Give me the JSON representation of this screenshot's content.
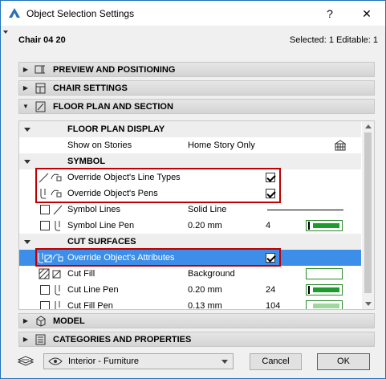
{
  "window": {
    "title": "Object Selection Settings",
    "help_label": "?",
    "close_label": "✕"
  },
  "object": {
    "name": "Chair 04 20",
    "selection_info": "Selected: 1 Editable: 1"
  },
  "panels": {
    "preview": "PREVIEW AND POSITIONING",
    "chair": "CHAIR SETTINGS",
    "floorplan": "FLOOR PLAN AND SECTION",
    "model": "MODEL",
    "categories": "CATEGORIES AND PROPERTIES"
  },
  "grid": {
    "floor_plan_display": {
      "label": "FLOOR PLAN DISPLAY",
      "show_on_stories_label": "Show on Stories",
      "show_on_stories_value": "Home Story Only"
    },
    "symbol": {
      "label": "SYMBOL",
      "override_line_types": "Override Object's Line Types",
      "override_pens": "Override Object's Pens",
      "symbol_lines_label": "Symbol Lines",
      "symbol_lines_value": "Solid Line",
      "symbol_line_pen_label": "Symbol Line Pen",
      "symbol_line_pen_value": "0.20 mm",
      "symbol_line_pen_number": "4"
    },
    "cut_surfaces": {
      "label": "CUT SURFACES",
      "override_attributes": "Override Object's Attributes",
      "cut_fill_label": "Cut Fill",
      "cut_fill_value": "Background",
      "cut_line_pen_label": "Cut Line Pen",
      "cut_line_pen_value": "0.20 mm",
      "cut_line_pen_number": "24",
      "cut_fill_pen_label": "Cut Fill Pen",
      "cut_fill_pen_value": "0.13 mm",
      "cut_fill_pen_number": "104"
    }
  },
  "checkbox_states": {
    "override_line_types": true,
    "override_pens": true,
    "override_attributes": true,
    "symbol_lines": false,
    "symbol_line_pen": false,
    "cut_line_pen": false
  },
  "footer": {
    "layer_value": "Interior - Furniture",
    "cancel_label": "Cancel",
    "ok_label": "OK"
  },
  "colors": {
    "accent": "#3c8ee8",
    "highlight_box": "#c00000",
    "pen_green": "#1f9a2e"
  }
}
